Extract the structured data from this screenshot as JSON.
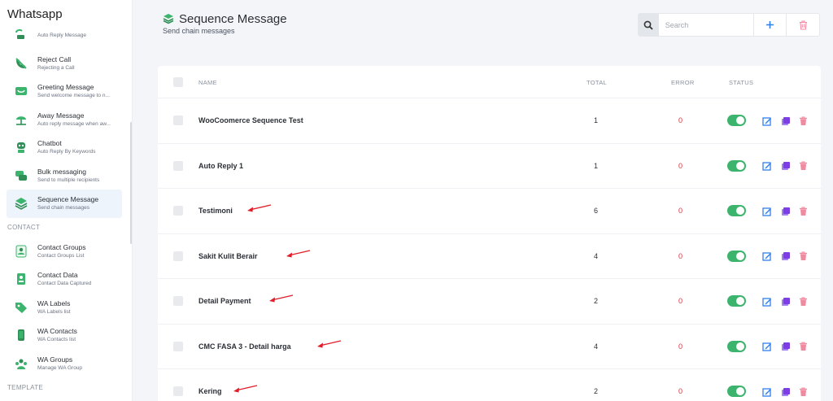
{
  "sidebar": {
    "title": "Whatsapp",
    "groups": [
      {
        "type": "item",
        "icon": "auto-reply-icon",
        "label": "",
        "sub": "Auto Reply Message"
      },
      {
        "type": "item",
        "icon": "reject-call-icon",
        "label": "Reject Call",
        "sub": "Rejecting a Call"
      },
      {
        "type": "item",
        "icon": "greeting-icon",
        "label": "Greeting Message",
        "sub": "Send welcome message to n..."
      },
      {
        "type": "item",
        "icon": "away-icon",
        "label": "Away Message",
        "sub": "Auto reply message when aw..."
      },
      {
        "type": "item",
        "icon": "chatbot-icon",
        "label": "Chatbot",
        "sub": "Auto Reply By Keywords"
      },
      {
        "type": "item",
        "icon": "bulk-icon",
        "label": "Bulk messaging",
        "sub": "Send to multiple recipients"
      },
      {
        "type": "item",
        "icon": "sequence-icon",
        "label": "Sequence Message",
        "sub": "Send chain messages",
        "active": true
      },
      {
        "type": "section",
        "label": "CONTACT"
      },
      {
        "type": "item",
        "icon": "contact-groups-icon",
        "label": "Contact Groups",
        "sub": "Contact Groups List"
      },
      {
        "type": "item",
        "icon": "contact-data-icon",
        "label": "Contact Data",
        "sub": "Contact Data Captured"
      },
      {
        "type": "item",
        "icon": "wa-labels-icon",
        "label": "WA Labels",
        "sub": "WA Labels list"
      },
      {
        "type": "item",
        "icon": "wa-contacts-icon",
        "label": "WA Contacts",
        "sub": "WA Contacts list"
      },
      {
        "type": "item",
        "icon": "wa-groups-icon",
        "label": "WA Groups",
        "sub": "Manage WA Group"
      },
      {
        "type": "section",
        "label": "TEMPLATE"
      }
    ]
  },
  "header": {
    "title": "Sequence Message",
    "subtitle": "Send chain messages",
    "search_placeholder": "Search"
  },
  "table": {
    "columns": {
      "name": "NAME",
      "total": "TOTAL",
      "error": "ERROR",
      "status": "STATUS"
    },
    "rows": [
      {
        "name": "WooCoomerce Sequence Test",
        "total": "1",
        "error": "0",
        "status_on": true,
        "marked": false
      },
      {
        "name": "Auto Reply 1",
        "total": "1",
        "error": "0",
        "status_on": true,
        "marked": false
      },
      {
        "name": "Testimoni",
        "total": "6",
        "error": "0",
        "status_on": true,
        "marked": true
      },
      {
        "name": "Sakit Kulit Berair",
        "total": "4",
        "error": "0",
        "status_on": true,
        "marked": true
      },
      {
        "name": "Detail Payment",
        "total": "2",
        "error": "0",
        "status_on": true,
        "marked": true
      },
      {
        "name": "CMC FASA 3 - Detail harga",
        "total": "4",
        "error": "0",
        "status_on": true,
        "marked": true
      },
      {
        "name": "Kering",
        "total": "2",
        "error": "0",
        "status_on": true,
        "marked": true
      }
    ]
  },
  "colors": {
    "accent_green": "#3cb46e",
    "edit_blue": "#2f80ed",
    "copy_purple": "#7b3fe4",
    "delete_pink": "#f08aa0",
    "error_red": "#e0303a",
    "annotation_red": "#e11d2a"
  }
}
